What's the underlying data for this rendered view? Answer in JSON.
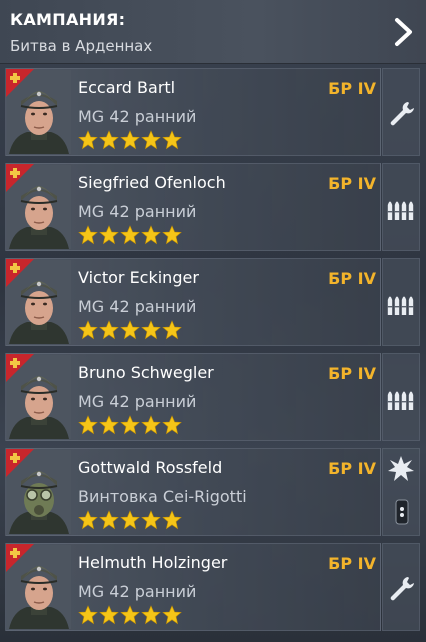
{
  "header": {
    "title": "КАМПАНИЯ:",
    "subtitle": "Битва в Арденнах",
    "next_icon": "chevron-right-icon"
  },
  "colors": {
    "accent": "#f3b42b",
    "star": "#f5c518",
    "badge_red": "#c8262c",
    "badge_cross": "#f2c744"
  },
  "soldiers": [
    {
      "name": "Eccard Bartl",
      "weapon": "MG 42 ранний",
      "br": "БР IV",
      "stars": 5,
      "action_icon": "wrench-icon",
      "mask": false
    },
    {
      "name": "Siegfried Ofenloch",
      "weapon": "MG 42 ранний",
      "br": "БР IV",
      "stars": 5,
      "action_icon": "ammo-icon",
      "mask": false
    },
    {
      "name": "Victor Eckinger",
      "weapon": "MG 42 ранний",
      "br": "БР IV",
      "stars": 5,
      "action_icon": "ammo-icon",
      "mask": false
    },
    {
      "name": "Bruno Schwegler",
      "weapon": "MG 42 ранний",
      "br": "БР IV",
      "stars": 5,
      "action_icon": "ammo-icon",
      "mask": false
    },
    {
      "name": "Gottwald Rossfeld",
      "weapon": "Винтовка Cei-Rigotti",
      "br": "БР IV",
      "stars": 5,
      "action_icon": "explosion-icon",
      "mask": true
    },
    {
      "name": "Helmuth Holzinger",
      "weapon": "MG 42 ранний",
      "br": "БР IV",
      "stars": 5,
      "action_icon": "wrench-icon",
      "mask": false
    }
  ]
}
